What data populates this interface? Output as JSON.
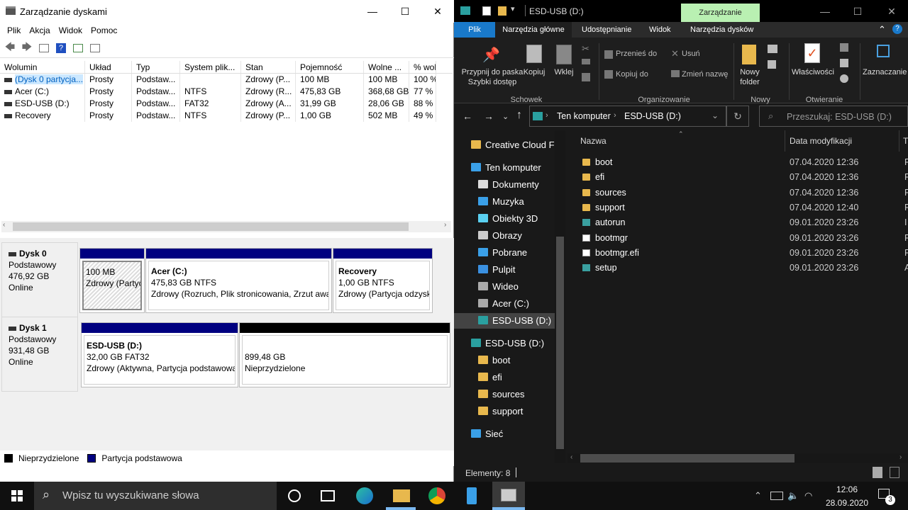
{
  "disk_mgmt": {
    "title": "Zarządzanie dyskami",
    "menu": [
      "Plik",
      "Akcja",
      "Widok",
      "Pomoc"
    ],
    "columns": [
      "Wolumin",
      "Układ",
      "Typ",
      "System plik...",
      "Stan",
      "Pojemność",
      "Wolne ...",
      "% wol"
    ],
    "rows": [
      [
        "(Dysk 0 partycja...",
        "Prosty",
        "Podstaw...",
        "",
        "Zdrowy (P...",
        "100 MB",
        "100 MB",
        "100 %"
      ],
      [
        "Acer (C:)",
        "Prosty",
        "Podstaw...",
        "NTFS",
        "Zdrowy (R...",
        "475,83 GB",
        "368,68 GB",
        "77 %"
      ],
      [
        "ESD-USB (D:)",
        "Prosty",
        "Podstaw...",
        "FAT32",
        "Zdrowy (A...",
        "31,99 GB",
        "28,06 GB",
        "88 %"
      ],
      [
        "Recovery",
        "Prosty",
        "Podstaw...",
        "NTFS",
        "Zdrowy (P...",
        "1,00 GB",
        "502 MB",
        "49 %"
      ]
    ],
    "disks": [
      {
        "name": "Dysk 0",
        "type": "Podstawowy",
        "size": "476,92 GB",
        "status": "Online",
        "partitions": [
          {
            "title": "",
            "size": "100 MB",
            "desc": "Zdrowy (Partycja"
          },
          {
            "title": "Acer  (C:)",
            "size": "475,83 GB NTFS",
            "desc": "Zdrowy (Rozruch, Plik stronicowania, Zrzut awa"
          },
          {
            "title": "Recovery",
            "size": "1,00 GB NTFS",
            "desc": "Zdrowy (Partycja odzysk"
          }
        ]
      },
      {
        "name": "Dysk 1",
        "type": "Podstawowy",
        "size": "931,48 GB",
        "status": "Online",
        "partitions": [
          {
            "title": "ESD-USB  (D:)",
            "size": "32,00 GB FAT32",
            "desc": "Zdrowy (Aktywna, Partycja podstawowa"
          },
          {
            "title": "",
            "size": "899,48 GB",
            "desc": "Nieprzydzielone"
          }
        ]
      }
    ],
    "legend": [
      "Nieprzydzielone",
      "Partycja podstawowa"
    ]
  },
  "explorer": {
    "title": "ESD-USB (D:)",
    "context_tab": "Zarządzanie",
    "tabs": [
      "Plik",
      "Narzędzia główne",
      "Udostępnianie",
      "Widok",
      "Narzędzia dysków"
    ],
    "ribbon": {
      "pin": "Przypnij do paska Szybki dostęp",
      "copy": "Kopiuj",
      "paste": "Wklej",
      "move_to": "Przenieś do",
      "copy_to": "Kopiuj do",
      "delete": "Usuń",
      "rename": "Zmień nazwę",
      "new_folder": "Nowy folder",
      "properties": "Właściwości",
      "select": "Zaznaczanie",
      "groups": [
        "Schowek",
        "Organizowanie",
        "Nowy",
        "Otwieranie"
      ]
    },
    "breadcrumb": [
      "Ten komputer",
      "ESD-USB (D:)"
    ],
    "search_placeholder": "Przeszukaj: ESD-USB (D:)",
    "nav": [
      "Creative Cloud File",
      "Ten komputer",
      "Dokumenty",
      "Muzyka",
      "Obiekty 3D",
      "Obrazy",
      "Pobrane",
      "Pulpit",
      "Wideo",
      "Acer (C:)",
      "ESD-USB (D:)",
      "ESD-USB (D:)",
      "boot",
      "efi",
      "sources",
      "support",
      "Sieć"
    ],
    "col_name": "Nazwa",
    "col_date": "Data modyfikacji",
    "col_type": "T",
    "files": [
      {
        "name": "boot",
        "date": "07.04.2020 12:36",
        "type": "F",
        "kind": "folder"
      },
      {
        "name": "efi",
        "date": "07.04.2020 12:36",
        "type": "F",
        "kind": "folder"
      },
      {
        "name": "sources",
        "date": "07.04.2020 12:36",
        "type": "F",
        "kind": "folder"
      },
      {
        "name": "support",
        "date": "07.04.2020 12:40",
        "type": "F",
        "kind": "folder"
      },
      {
        "name": "autorun",
        "date": "09.01.2020 23:26",
        "type": "I",
        "kind": "setup"
      },
      {
        "name": "bootmgr",
        "date": "09.01.2020 23:26",
        "type": "P",
        "kind": "doc"
      },
      {
        "name": "bootmgr.efi",
        "date": "09.01.2020 23:26",
        "type": "P",
        "kind": "doc"
      },
      {
        "name": "setup",
        "date": "09.01.2020 23:26",
        "type": "A",
        "kind": "setup"
      }
    ],
    "status": "Elementy: 8"
  },
  "taskbar": {
    "search": "Wpisz tu wyszukiwane słowa",
    "time": "12:06",
    "date": "28.09.2020",
    "notif_count": "3"
  }
}
